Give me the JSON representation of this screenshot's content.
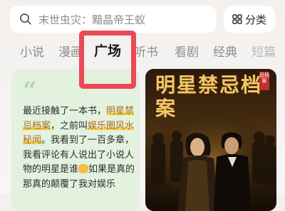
{
  "search": {
    "text": "末世虫灾：黯晶帝王蚁",
    "icon": "search-icon"
  },
  "category_button": {
    "label": "分类",
    "icon": "grid-icon"
  },
  "tabs": [
    {
      "label": "小说",
      "active": false
    },
    {
      "label": "漫画",
      "active": false
    },
    {
      "label": "广场",
      "active": true
    },
    {
      "label": "听书",
      "active": false
    },
    {
      "label": "看剧",
      "active": false
    },
    {
      "label": "经典",
      "active": false
    },
    {
      "label": "短篇",
      "active": false
    }
  ],
  "review_card": {
    "quote_icon": "quote-icon",
    "text_intro": "最近接触了一本书，",
    "book_title": "明星禁忌档案",
    "text_mid": "，之前叫",
    "alt_title": "娱乐圈风水秘闻",
    "text_body": "。我看到了一百多章，我看评论有人说出了小说人物的明星是谁",
    "text_tail": "如果是真的",
    "text_cut": "那真的颠覆了我对娱乐"
  },
  "cover": {
    "title": "明星禁忌档案",
    "badge": "忌档案"
  },
  "colors": {
    "highlight_border": "#ea4a55",
    "card_green": "#e3f1df",
    "cover_gold": "#f2c768",
    "link_orange": "#b06a10"
  }
}
